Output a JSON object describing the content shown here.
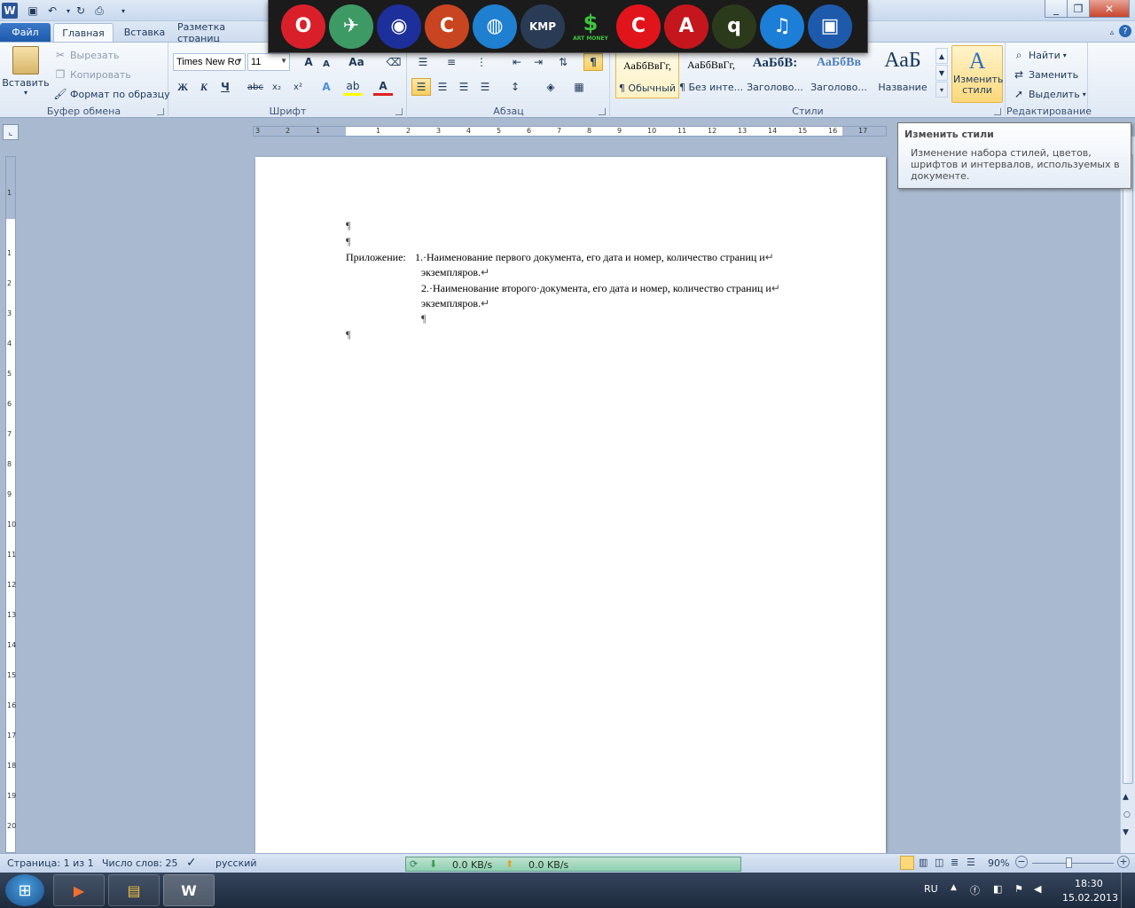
{
  "title_bar": {
    "app_letter": "W",
    "qat_icons": [
      "save-icon",
      "undo-icon",
      "redo-icon",
      "print-preview-icon"
    ],
    "window_controls": [
      "_",
      "❐",
      "✕"
    ]
  },
  "dock": {
    "icons": [
      {
        "name": "opera-icon",
        "glyph": "O",
        "color": "#d9202a"
      },
      {
        "name": "bird-icon",
        "glyph": "✈",
        "color": "#3d9a64"
      },
      {
        "name": "media-disc-icon",
        "glyph": "◉",
        "color": "#1c2f9a"
      },
      {
        "name": "ccleaner-icon",
        "glyph": "C",
        "color": "#c94420"
      },
      {
        "name": "globe-icon",
        "glyph": "◍",
        "color": "#1f7fd1"
      },
      {
        "name": "kmplayer-icon",
        "glyph": "KMP",
        "color": "#2a3b55"
      },
      {
        "name": "artmoney-icon",
        "glyph": "$",
        "color": "#1b1b1b"
      },
      {
        "name": "red-c-icon",
        "glyph": "C",
        "color": "#e1141b"
      },
      {
        "name": "pdf-icon",
        "glyph": "A",
        "color": "#c4161c"
      },
      {
        "name": "qip-icon",
        "glyph": "q",
        "color": "#2c3a1c"
      },
      {
        "name": "itunes-icon",
        "glyph": "♫",
        "color": "#1c7ed6"
      },
      {
        "name": "desktop-icon",
        "glyph": "▣",
        "color": "#1d5aab"
      }
    ],
    "artmoney_caption": "ART MONEY"
  },
  "tabs": {
    "file": "Файл",
    "home": "Главная",
    "insert": "Вставка",
    "layout": "Разметка страниц"
  },
  "clipboard": {
    "paste": "Вставить",
    "cut": "Вырезать",
    "copy": "Копировать",
    "format_painter": "Формат по образцу",
    "label": "Буфер обмена"
  },
  "font": {
    "family": "Times New Ro",
    "size": "11",
    "bold": "Ж",
    "italic": "К",
    "underline": "Ч",
    "strike": "abc",
    "subscript": "x₂",
    "superscript": "x²",
    "case": "Aa",
    "grow": "A",
    "shrink": "A",
    "label": "Шрифт"
  },
  "paragraph": {
    "label": "Абзац",
    "pilcrow": "¶"
  },
  "styles": {
    "tiles": [
      {
        "preview": "АаБбВвГг,",
        "name": "¶ Обычный"
      },
      {
        "preview": "АаБбВвГг,",
        "name": "¶ Без инте..."
      },
      {
        "preview": "АаБбВ:",
        "name": "Заголово..."
      },
      {
        "preview": "АаБбВв",
        "name": "Заголово..."
      },
      {
        "preview": "АаБ",
        "name": "Название"
      }
    ],
    "change_styles": "Изменить стили",
    "label": "Стили"
  },
  "editing": {
    "find": "Найти",
    "replace": "Заменить",
    "select": "Выделить",
    "label": "Редактирование"
  },
  "tooltip": {
    "title": "Изменить стили",
    "body": "Изменение набора стилей, цветов, шрифтов и интервалов, используемых в документе."
  },
  "document": {
    "pilcrow": "¶",
    "appendix_label": "Приложение:",
    "item1_line1": "1.·Наименование первого документа, его дата и номер, количество страниц и",
    "item1_line2": "экземпляров.",
    "item2_line1": "2.·Наименование второго·документа, его дата и номер, количество страниц и",
    "item2_line2": "экземпляров.",
    "line_break": "↵"
  },
  "status": {
    "page": "Страница: 1 из 1",
    "words": "Число слов: 25",
    "language": "русский",
    "down_speed": "0.0 KB/s",
    "up_speed": "0.0 KB/s",
    "zoom": "90%",
    "zoom_level_fraction": 0.45
  },
  "taskbar": {
    "lang": "RU",
    "time": "18:30",
    "date": "15.02.2013"
  },
  "ruler": {
    "h_numbers": [
      "3",
      "2",
      "1",
      "",
      "1",
      "2",
      "3",
      "4",
      "5",
      "6",
      "7",
      "8",
      "9",
      "10",
      "11",
      "12",
      "13",
      "14",
      "15",
      "16",
      "17"
    ],
    "v_numbers": [
      "1",
      "",
      "1",
      "2",
      "3",
      "4",
      "5",
      "6",
      "7",
      "8",
      "9",
      "10",
      "11",
      "12",
      "13",
      "14",
      "15",
      "16",
      "17",
      "18",
      "19",
      "20",
      "21"
    ]
  }
}
